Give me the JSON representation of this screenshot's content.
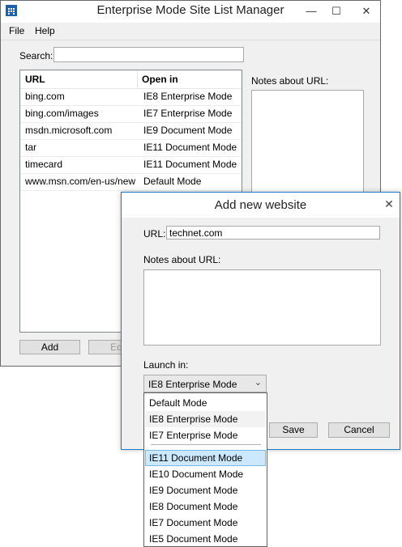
{
  "main_window": {
    "title": "Enterprise Mode Site List Manager",
    "menu": [
      "File",
      "Help"
    ],
    "search_label": "Search:",
    "columns": [
      "URL",
      "Open in"
    ],
    "rows": [
      {
        "url": "bing.com",
        "mode": "IE8 Enterprise Mode"
      },
      {
        "url": "bing.com/images",
        "mode": "IE7 Enterprise Mode"
      },
      {
        "url": "msdn.microsoft.com",
        "mode": "IE9 Document Mode"
      },
      {
        "url": "tar",
        "mode": "IE11 Document Mode"
      },
      {
        "url": "timecard",
        "mode": "IE11 Document Mode"
      },
      {
        "url": "www.msn.com/en-us/news",
        "mode": "Default Mode"
      }
    ],
    "notes_label": "Notes about URL:",
    "add_label": "Add",
    "edit_label": "Edit"
  },
  "dialog": {
    "title": "Add new website",
    "url_label": "URL:",
    "url_value": "technet.com",
    "notes_label": "Notes about URL:",
    "launch_label": "Launch in:",
    "selected": "IE8 Enterprise Mode",
    "save_label": "Save",
    "cancel_label": "Cancel",
    "options": [
      "Default Mode",
      "IE8 Enterprise Mode",
      "IE7 Enterprise Mode",
      "IE11 Document Mode",
      "IE10 Document Mode",
      "IE9 Document Mode",
      "IE8 Document Mode",
      "IE7 Document Mode",
      "IE5 Document Mode"
    ]
  },
  "icons": {
    "minimize": "minimize-icon",
    "maximize": "maximize-icon",
    "close": "close-icon",
    "dropdown": "chevron-down-icon"
  },
  "colors": {
    "dialog_border": "#1979ca",
    "selected_option": "#cce8ff",
    "app_icon": "#1f5fa8"
  }
}
